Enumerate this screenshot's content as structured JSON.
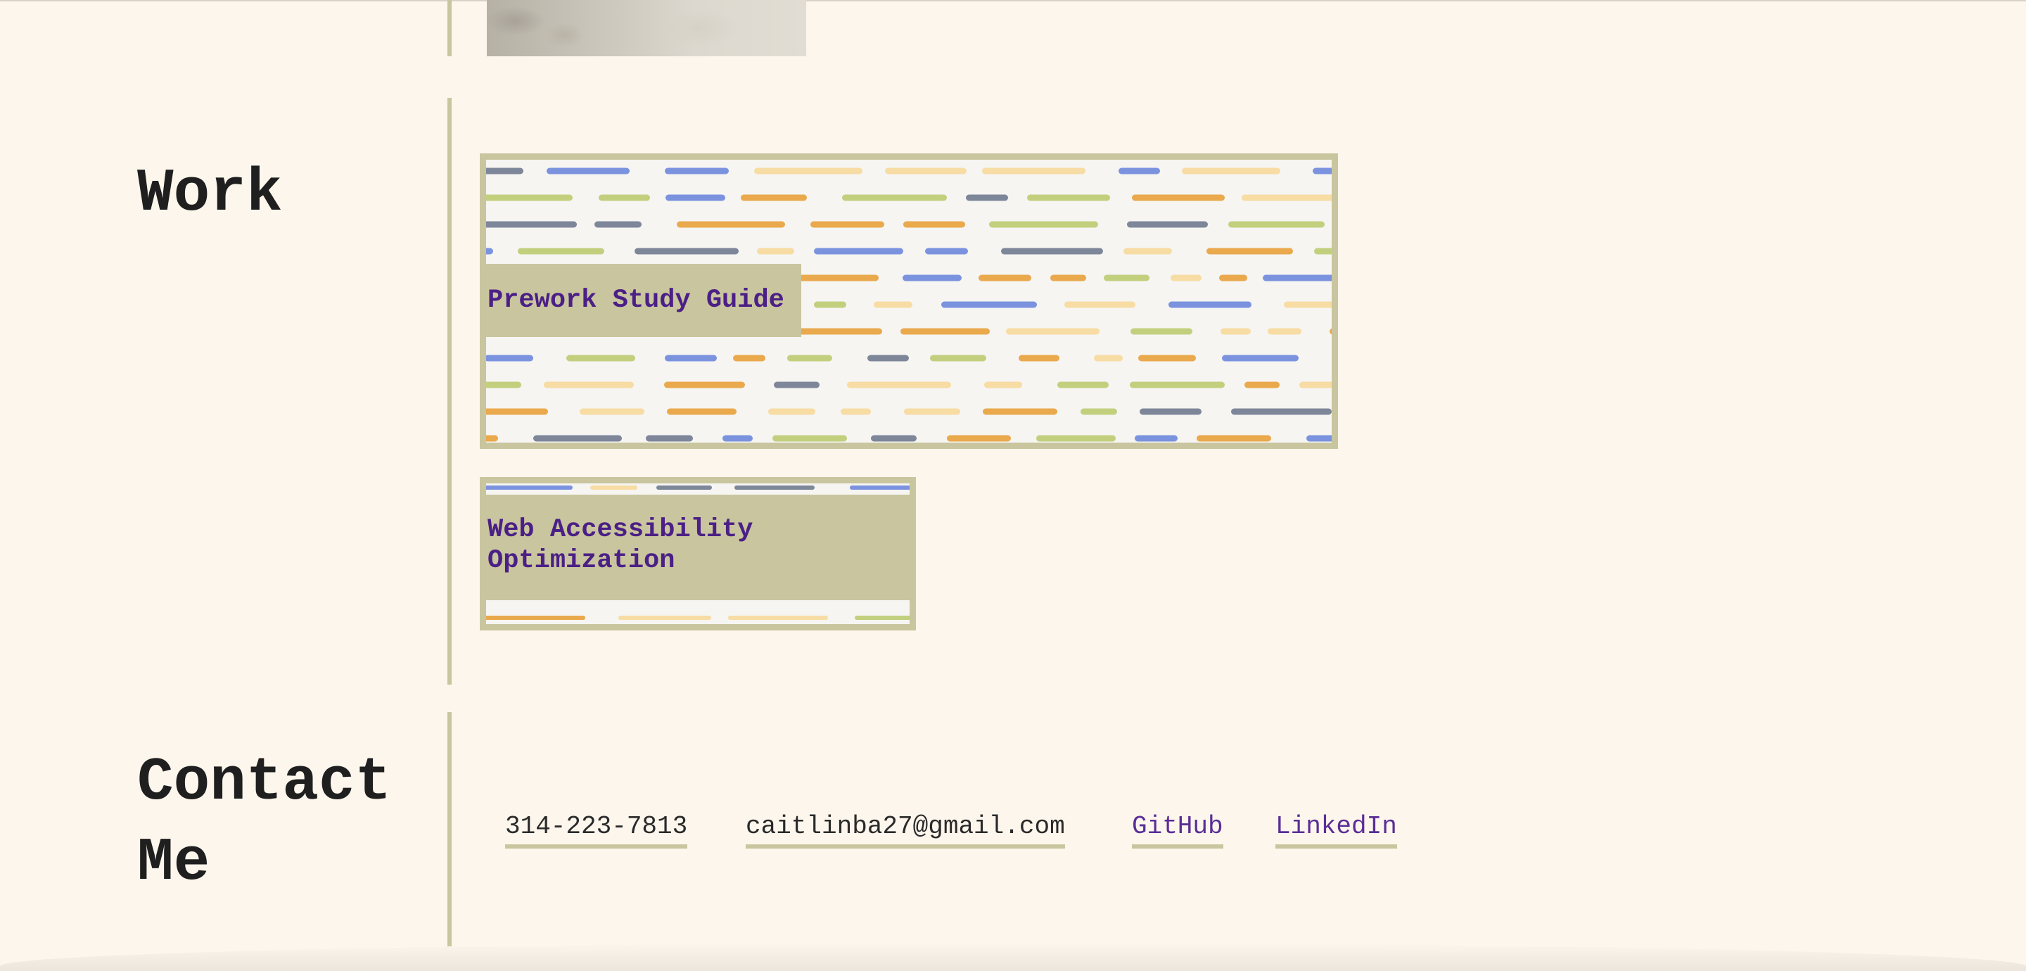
{
  "sections": {
    "work": {
      "title": "Work",
      "projects": [
        {
          "label": "Prework Study Guide"
        },
        {
          "label": "Web Accessibility Optimization"
        }
      ]
    },
    "contact": {
      "title_line1": "Contact",
      "title_line2": "Me",
      "phone": "314-223-7813",
      "email": "caitlinba27@gmail.com",
      "github": "GitHub",
      "linkedin": "LinkedIn"
    }
  },
  "colors": {
    "background": "#fdf6ec",
    "accent": "#c9c59e",
    "link": "#5a2e97",
    "heading": "#1f1f1f",
    "pattern": [
      "#e9a94c",
      "#7b93df",
      "#c2d07e",
      "#f7dca3",
      "#7e8799"
    ]
  }
}
